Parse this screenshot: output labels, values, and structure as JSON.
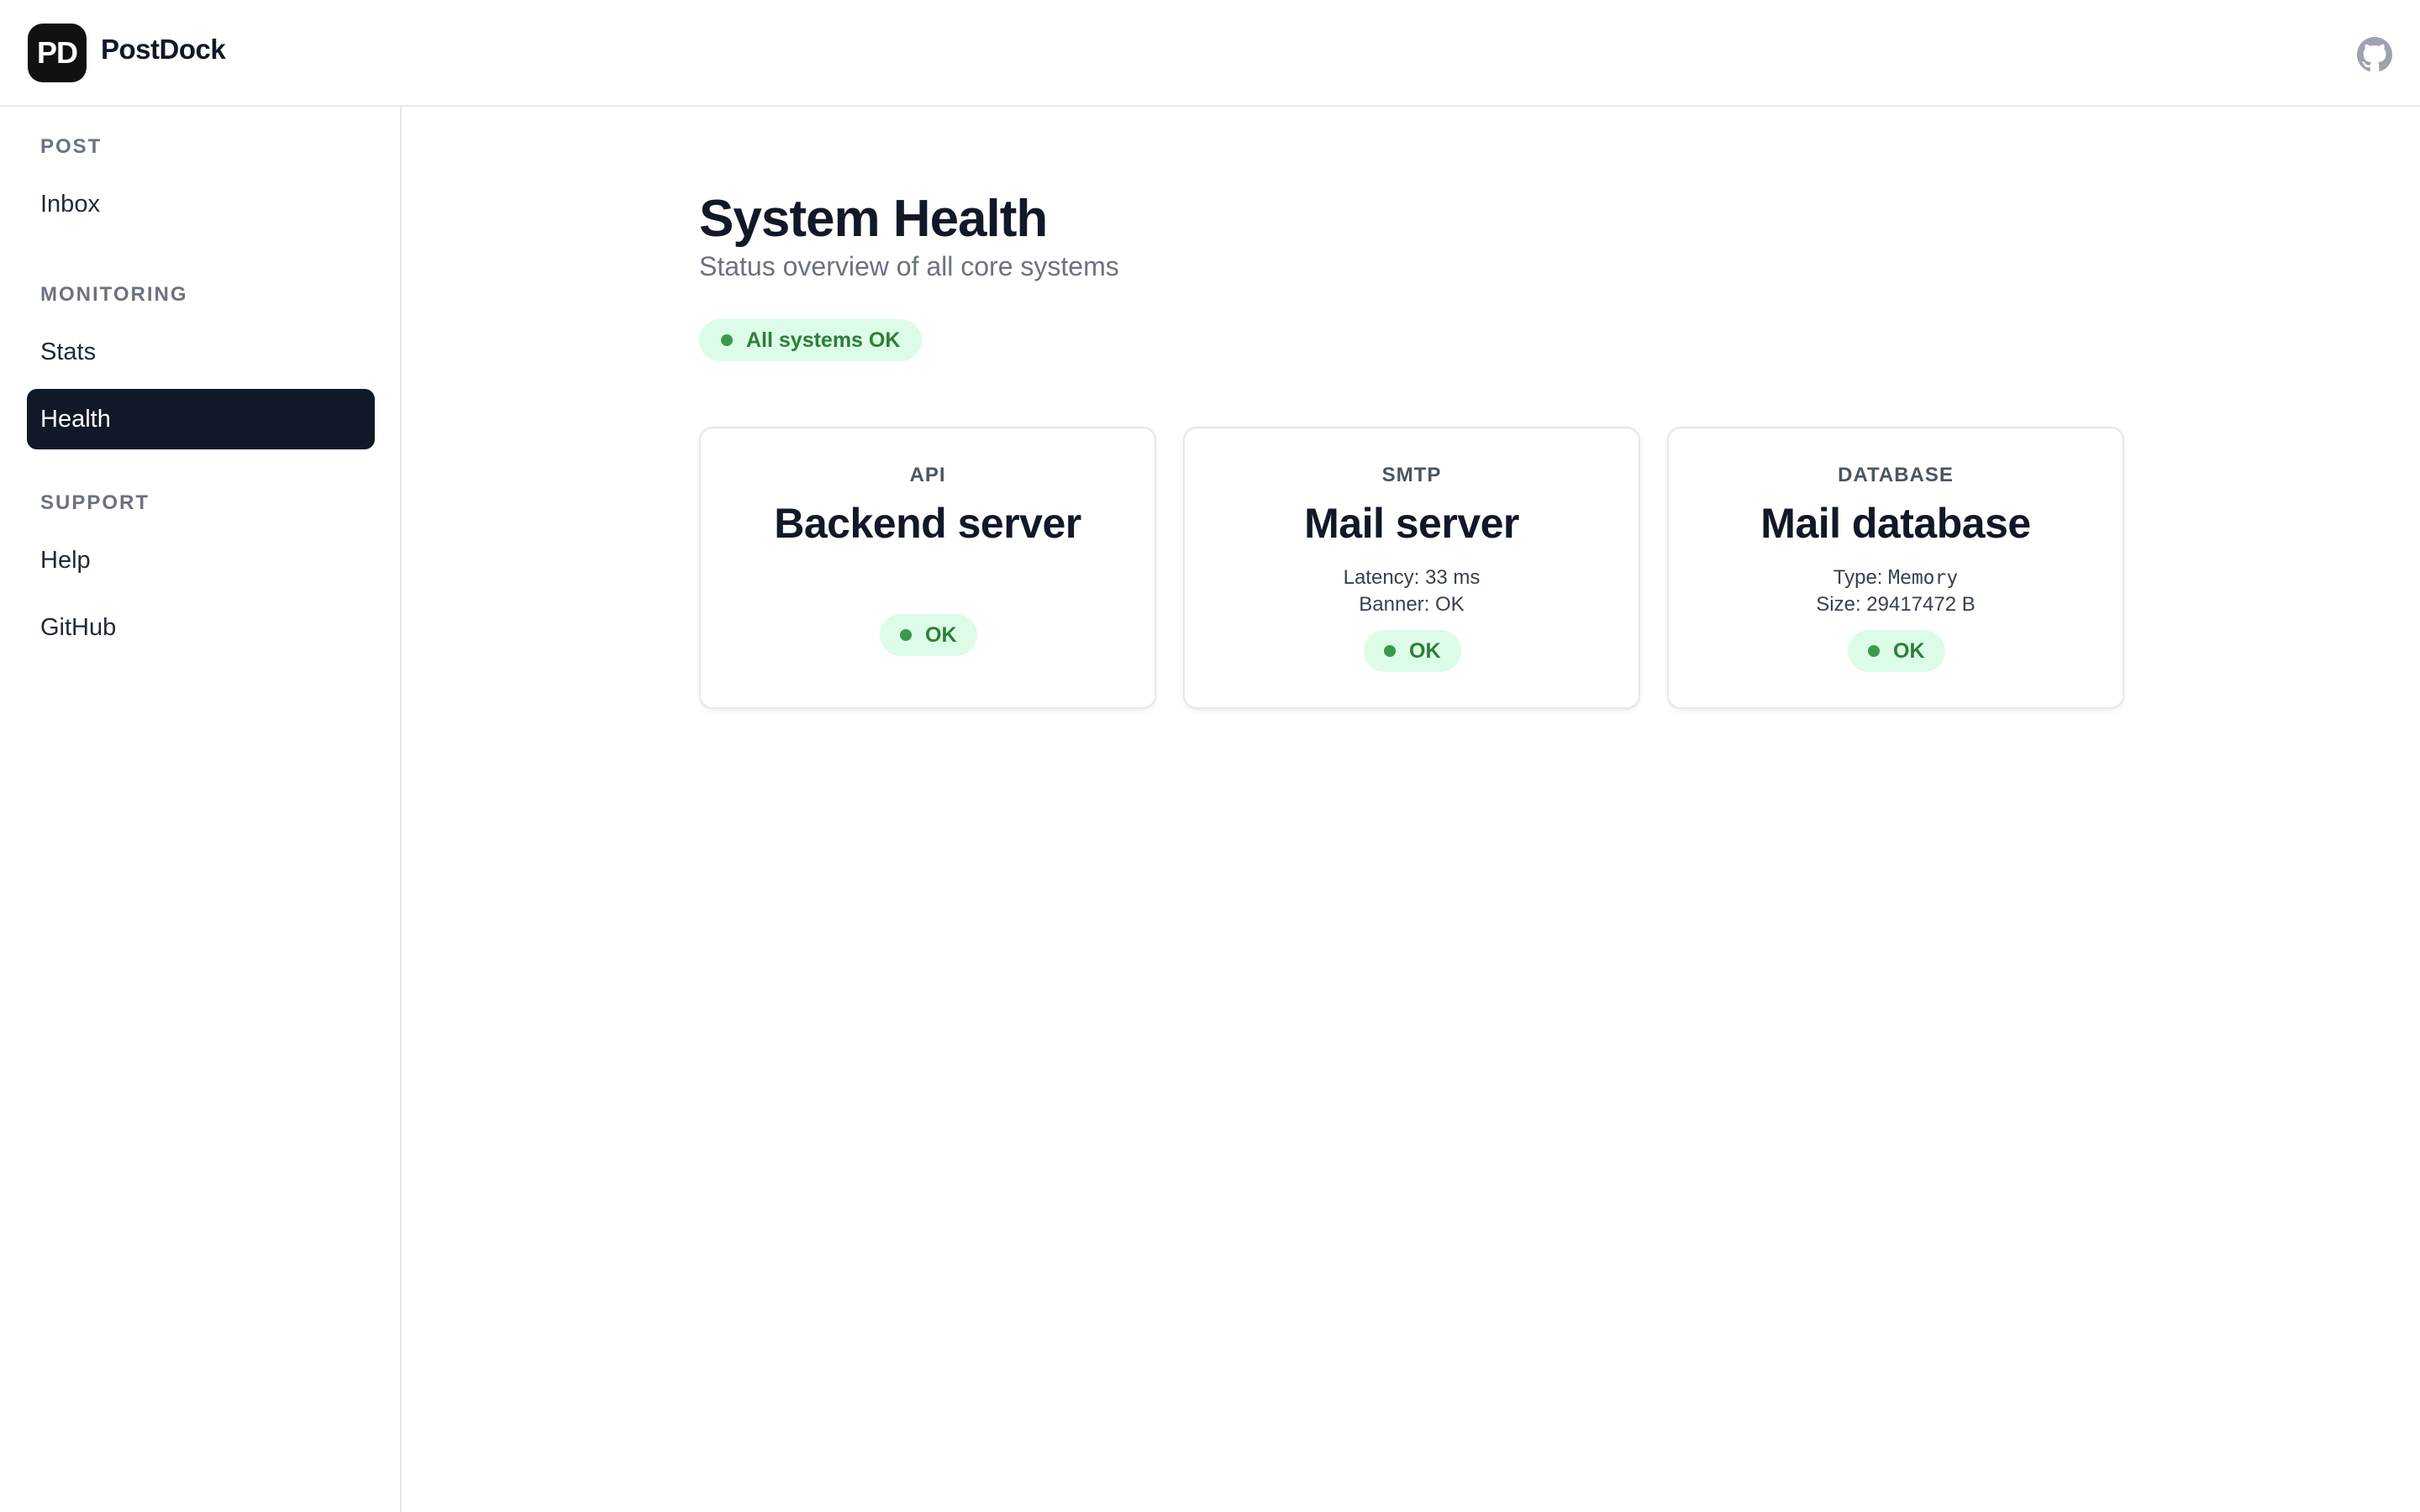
{
  "app": {
    "logo_text": "PD",
    "name": "PostDock",
    "github_icon": "github-icon"
  },
  "sidebar": {
    "sections": [
      {
        "label": "POST",
        "items": [
          {
            "label": "Inbox",
            "active": false
          }
        ]
      },
      {
        "label": "MONITORING",
        "items": [
          {
            "label": "Stats",
            "active": false
          },
          {
            "label": "Health",
            "active": true
          }
        ]
      },
      {
        "label": "SUPPORT",
        "items": [
          {
            "label": "Help",
            "active": false
          },
          {
            "label": "GitHub",
            "active": false
          }
        ]
      }
    ]
  },
  "main": {
    "title": "System Health",
    "subtitle": "Status overview of all core systems",
    "overall_status": "All systems OK",
    "cards": [
      {
        "kicker": "API",
        "title": "Backend server",
        "details": [],
        "status": "OK"
      },
      {
        "kicker": "SMTP",
        "title": "Mail server",
        "details": [
          {
            "label": "Latency:",
            "value": "33 ms"
          },
          {
            "label": "Banner:",
            "value": "OK"
          }
        ],
        "status": "OK"
      },
      {
        "kicker": "DATABASE",
        "title": "Mail database",
        "details": [
          {
            "label": "Type:",
            "value": "Memory"
          },
          {
            "label": "Size:",
            "value": "29417472 B"
          }
        ],
        "status": "OK"
      }
    ]
  },
  "colors": {
    "accent_dark": "#111827",
    "ok_background": "#dcfce7",
    "ok_text": "#2f7d3a",
    "ok_dot": "#3b9a4a"
  }
}
